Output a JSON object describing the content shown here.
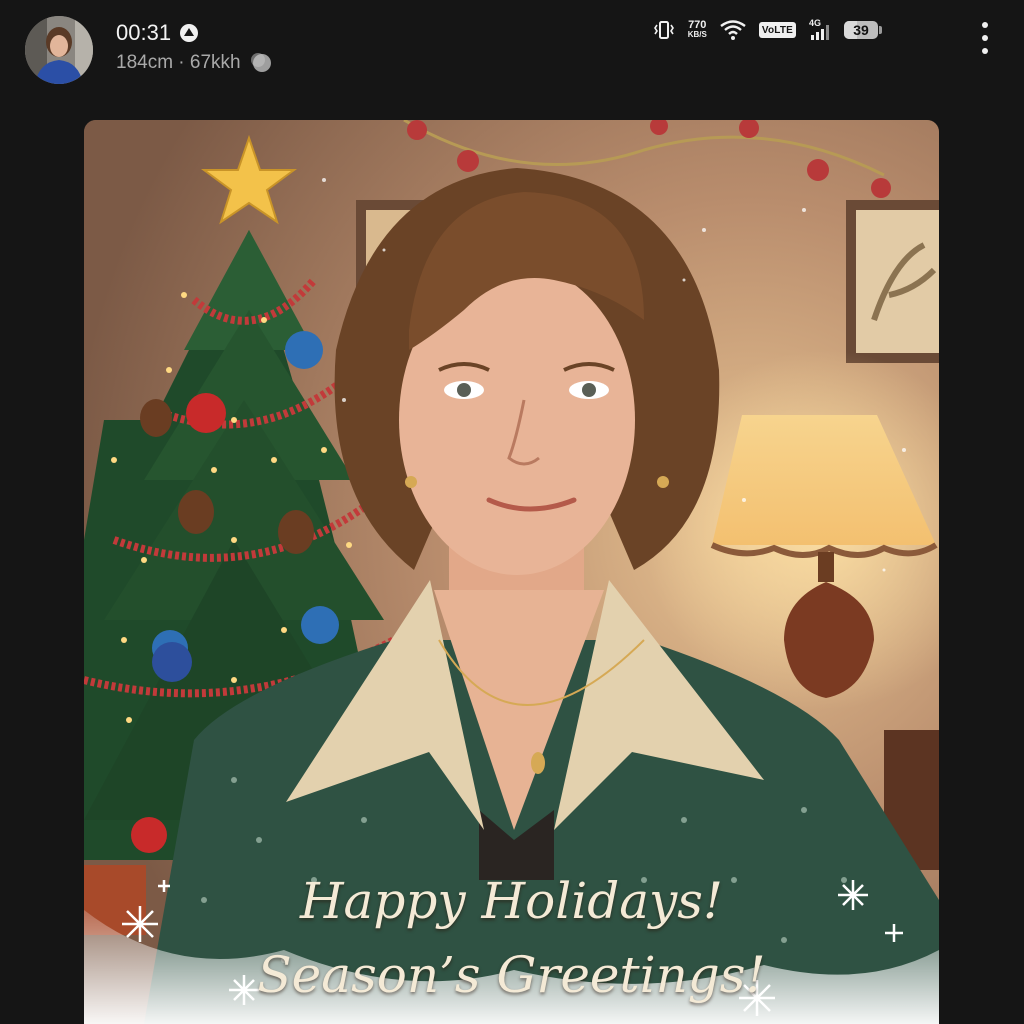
{
  "header": {
    "time": "00:31",
    "subtitle": "184cm · 67kkh",
    "avatar_icon": "profile-photo",
    "app_icon": "circle-triangle-icon",
    "moon_icon": "moon-icon"
  },
  "status_bar": {
    "vibrate_icon": "vibrate-icon",
    "speed_value": "770",
    "speed_unit": "KB/S",
    "wifi_icon": "wifi-icon",
    "volte_label": "VoLTE",
    "network_label": "4G",
    "battery_level": "39",
    "battery_fraction": 0.39
  },
  "menu": {
    "more_icon": "more-vertical-icon"
  },
  "card": {
    "line1": "Happy Holidays!",
    "line2": "Season’s Greetings!"
  },
  "colors": {
    "background": "#151515",
    "sweater": "#2f5243",
    "text_cream": "#f4ead6"
  }
}
